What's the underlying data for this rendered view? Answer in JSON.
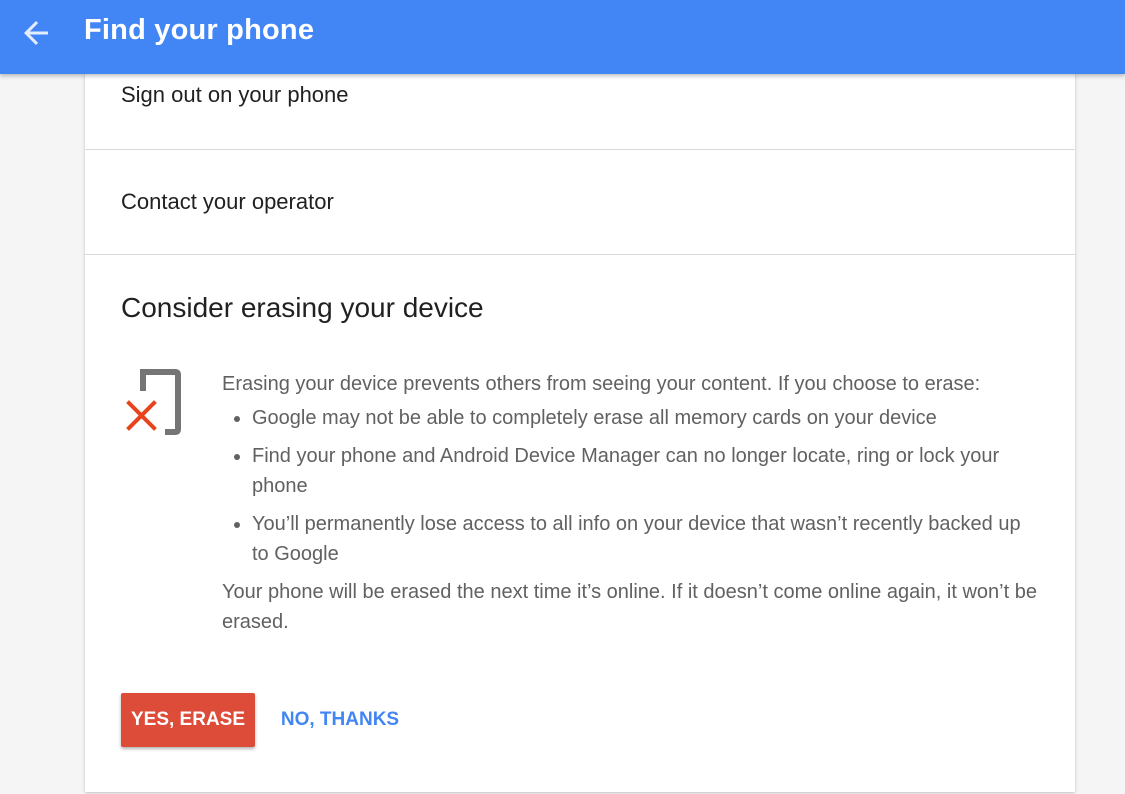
{
  "header": {
    "title": "Find your phone",
    "back_icon": "arrow-back-icon"
  },
  "options": {
    "sign_out": "Sign out on your phone",
    "contact_operator": "Contact your operator"
  },
  "erase": {
    "heading": "Consider erasing your device",
    "icon": "phone-erase-icon",
    "intro": "Erasing your device prevents others from seeing your content. If you choose to erase:",
    "bullets": [
      "Google may not be able to completely erase all memory cards on your device",
      "Find your phone and Android Device Manager can no longer locate, ring or lock your phone",
      "You’ll permanently lose access to all info on your device that wasn’t recently backed up to Google"
    ],
    "note": "Your phone will be erased the next time it’s online. If it doesn’t come online again, it won’t be erased.",
    "confirm_label": "YES, ERASE",
    "cancel_label": "NO, THANKS"
  },
  "colors": {
    "header_bg": "#4285f4",
    "erase_button": "#dd4b39",
    "link_blue": "#4285f4",
    "icon_x": "#e8431c",
    "icon_phone": "#757575"
  }
}
